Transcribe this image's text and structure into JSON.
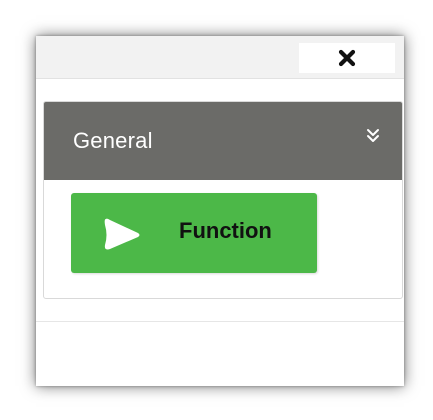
{
  "titlebar": {
    "close_icon": "close-icon"
  },
  "section": {
    "title": "General",
    "toggle_icon": "chevron-double-down-icon",
    "header_color": "#6b6b68"
  },
  "blocks": [
    {
      "label": "Function",
      "icon": "play-icon",
      "color": "#4cb848"
    }
  ]
}
